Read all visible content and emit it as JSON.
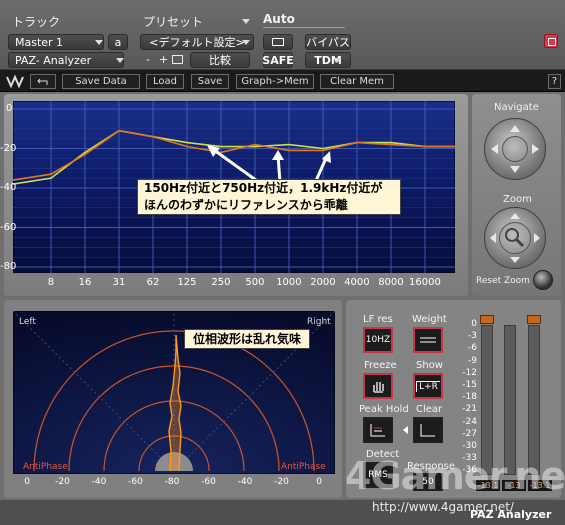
{
  "host": {
    "track_label": "トラック",
    "preset_label": "プリセット",
    "auto_label": "Auto",
    "track_name": "Master 1",
    "track_channel": "a",
    "plugin_name": "PAZ- Analyzer",
    "preset_name": "<デフォルト設定>",
    "minus": "-",
    "plus": "+",
    "compare": "比較",
    "bypass": "バイパス",
    "safe": "SAFE",
    "tdm": "TDM"
  },
  "toolbar": {
    "save_data": "Save Data",
    "load": "Load",
    "save": "Save",
    "graph_mem": "Graph->Mem",
    "clear_mem": "Clear Mem",
    "help": "?"
  },
  "freq_axis": {
    "y_ticks": [
      "0",
      "-20",
      "-40",
      "-60",
      "-80"
    ],
    "x_ticks": [
      "8",
      "16",
      "31",
      "62",
      "125",
      "250",
      "500",
      "1000",
      "2000",
      "4000",
      "8000",
      "16000"
    ]
  },
  "right_panel": {
    "navigate": "Navigate",
    "zoom": "Zoom",
    "reset_zoom": "Reset Zoom"
  },
  "phase": {
    "left": "Left",
    "right": "Right",
    "anti_phase_left": "AntiPhase",
    "anti_phase_right": "AntiPhase",
    "axis_ticks": [
      "0",
      "-20",
      "-40",
      "-60",
      "-80",
      "-60",
      "-40",
      "-20",
      "0"
    ]
  },
  "controls": {
    "lf_res": "LF res",
    "lf_res_value": "10HZ",
    "weight": "Weight",
    "freeze": "Freeze",
    "show": "Show",
    "show_value": "L+R",
    "peak_hold": "Peak Hold",
    "clear": "Clear",
    "detect": "Detect",
    "detect_value": "RMS",
    "response": "Response",
    "response_value": "50"
  },
  "meters": {
    "scale": [
      "0",
      "-3",
      "-6",
      "-9",
      "-12",
      "-15",
      "-18",
      "-21",
      "-24",
      "-27",
      "-30",
      "-33",
      "-36"
    ],
    "readouts": [
      "-13.1",
      "-13",
      "-13.1"
    ]
  },
  "annotations": {
    "freq_note_line1": "150Hz付近と750Hz付近，1.9kHz付近が",
    "freq_note_line2": "ほんのわずかにリファレンスから乖離",
    "phase_note": "位相波形は乱れ気味"
  },
  "footer": {
    "watermark": "4Gamer.net",
    "url": "http://www.4gamer.net/",
    "plugin_name": "PAZ Analyzer"
  },
  "chart_data": {
    "type": "line",
    "x": [
      8,
      16,
      31,
      62,
      125,
      250,
      500,
      1000,
      2000,
      4000,
      8000,
      16000
    ],
    "ylim": [
      -80,
      0
    ],
    "series": [
      {
        "values": [
          -35,
          -22,
          -11,
          -14,
          -17,
          -19,
          -19,
          -18,
          -20,
          -17,
          -17,
          -19
        ]
      },
      {
        "values": [
          -33,
          -23,
          -11,
          -14,
          -19,
          -22,
          -18,
          -21,
          -21,
          -17,
          -18,
          -19
        ]
      }
    ],
    "colors": [
      "#c8e34a",
      "#e0781e"
    ]
  },
  "colors": {
    "accent": "#c7354b",
    "screen_bg": "#0b1550",
    "phase_trace": "#ff9a1f"
  }
}
